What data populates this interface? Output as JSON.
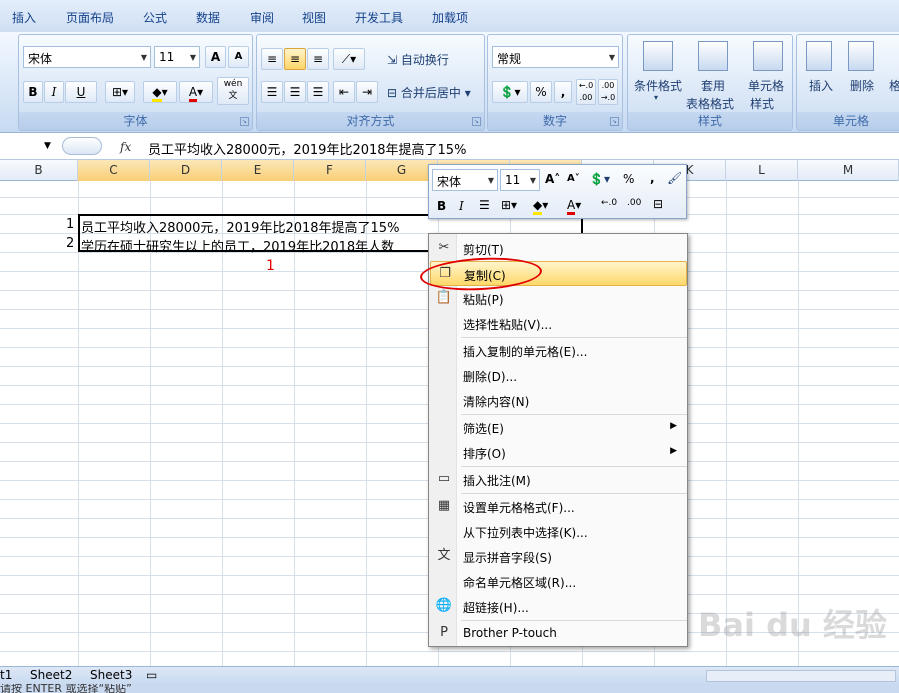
{
  "tabs": [
    "插入",
    "页面布局",
    "公式",
    "数据",
    "审阅",
    "视图",
    "开发工具",
    "加载项"
  ],
  "ribbon": {
    "font": {
      "family": "宋体",
      "size": "11",
      "label": "字体",
      "inc": "A",
      "dec": "A",
      "bold": "B",
      "italic": "I",
      "underline": "U",
      "wen": "wén\n文"
    },
    "align": {
      "label": "对齐方式",
      "wrap": "自动换行",
      "merge": "合并后居中"
    },
    "number": {
      "label": "数字",
      "format": "常规",
      "percent": "%",
      "comma": ",",
      "inc_dec": "←.0\n.00",
      "dec_dec": ".00\n→.0"
    },
    "styles": {
      "label": "样式",
      "cond": "条件格式",
      "table1": "套用",
      "table2": "表格格式",
      "cell1": "单元格",
      "cell2": "样式"
    },
    "cells": {
      "label": "单元格",
      "insert": "插入",
      "delete": "删除",
      "format": "格"
    }
  },
  "formula_bar": {
    "fx": "fx",
    "value": "员工平均收入28000元，2019年比2018年提高了15%"
  },
  "columns": [
    "B",
    "C",
    "D",
    "E",
    "F",
    "G",
    "H",
    "I",
    "J",
    "K",
    "L",
    "M"
  ],
  "rows": [
    {
      "num": "1",
      "text": "员工平均收入28000元，2019年比2018年提高了15%"
    },
    {
      "num": "2",
      "text": "学历在硕士研究生以上的员工，2019年比2018年人数"
    }
  ],
  "annotation": {
    "mark1": "1",
    "mark2": "2"
  },
  "mini_toolbar": {
    "font": "宋体",
    "size": "11",
    "percent": "%",
    "comma": ",",
    "bold": "B",
    "italic": "I"
  },
  "context_menu": [
    {
      "label": "剪切(T)",
      "icon": "scissors-icon",
      "glyph": "✂"
    },
    {
      "label": "复制(C)",
      "icon": "copy-icon",
      "glyph": "❐",
      "highlight": true
    },
    {
      "label": "粘贴(P)",
      "icon": "paste-icon",
      "glyph": "📋"
    },
    {
      "label": "选择性粘贴(V)...",
      "sep_after": true
    },
    {
      "label": "插入复制的单元格(E)..."
    },
    {
      "label": "删除(D)..."
    },
    {
      "label": "清除内容(N)",
      "sep_after": true
    },
    {
      "label": "筛选(E)",
      "submenu": true
    },
    {
      "label": "排序(O)",
      "submenu": true,
      "sep_after": true
    },
    {
      "label": "插入批注(M)",
      "icon": "comment-icon",
      "glyph": "▭",
      "sep_after": true
    },
    {
      "label": "设置单元格格式(F)...",
      "icon": "format-cells-icon",
      "glyph": "▦"
    },
    {
      "label": "从下拉列表中选择(K)..."
    },
    {
      "label": "显示拼音字段(S)",
      "icon": "phonetic-icon",
      "glyph": "文"
    },
    {
      "label": "命名单元格区域(R)..."
    },
    {
      "label": "超链接(H)...",
      "icon": "hyperlink-icon",
      "glyph": "🌐",
      "sep_after": true
    },
    {
      "label": "Brother P-touch",
      "icon": "ptouch-icon",
      "glyph": "P"
    }
  ],
  "sheets": [
    "t1",
    "Sheet2",
    "Sheet3"
  ],
  "status": "请按 ENTER 或选择“粘贴”",
  "watermark": "Bai du 经验"
}
